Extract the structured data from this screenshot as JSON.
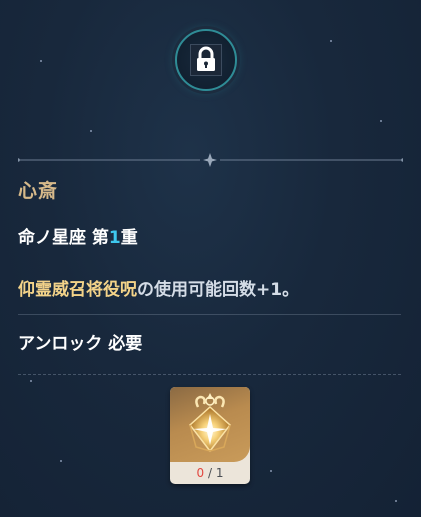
{
  "lock": {
    "icon": "padlock-icon",
    "ring_color": "#2f8c96"
  },
  "constellation": {
    "name": "心斎",
    "level_prefix": "命ノ星座 第",
    "level_number": "1",
    "level_suffix": "重",
    "effect_highlight": "仰霊威召将役呪",
    "effect_rest": "の使用可能回数+1。"
  },
  "requirement": {
    "label": "アンロック 必要",
    "item": {
      "icon": "constellation-gem-icon",
      "have": "0",
      "separator": " / ",
      "need": "1"
    }
  },
  "colors": {
    "title": "#d6b98a",
    "highlight": "#f3d389",
    "number_accent": "#3ec8ee",
    "insufficient": "#e2473f"
  }
}
